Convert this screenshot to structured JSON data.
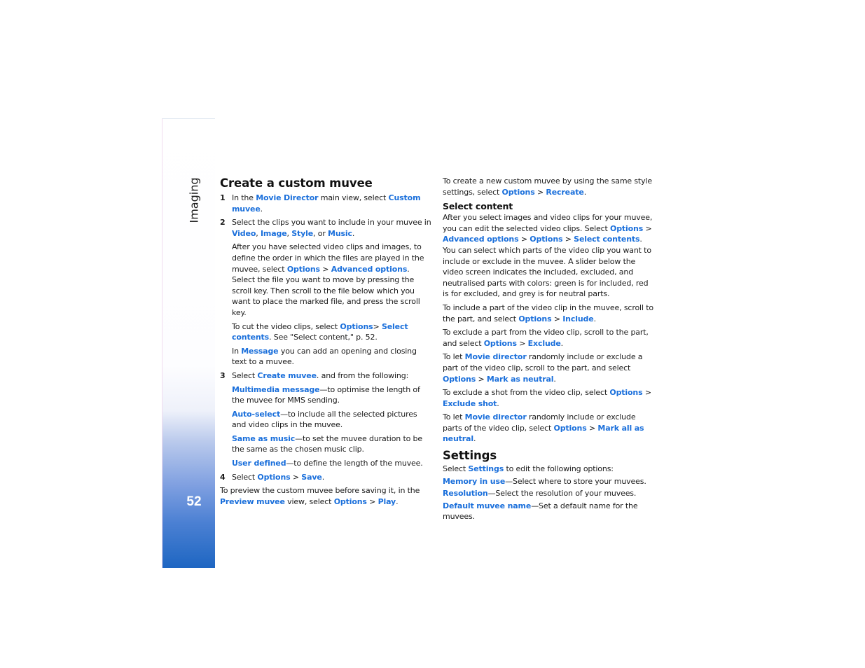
{
  "sidebar": {
    "section": "Imaging",
    "page_number": "52"
  },
  "colors": {
    "link": "#1a6fdb",
    "sidebar_bottom": "#1e66c2"
  },
  "left": {
    "title": "Create a custom muvee",
    "step1": {
      "num": "1",
      "t1": "In the ",
      "l1": "Movie Director",
      "t2": " main view, select ",
      "l2": "Custom muvee",
      "t3": "."
    },
    "step2": {
      "num": "2",
      "t1": "Select the clips you want to include in your muvee in ",
      "l1": "Video",
      "t2": ", ",
      "l2": "Image",
      "t3": ", ",
      "l3": "Style",
      "t4": ", or ",
      "l4": "Music",
      "t5": "."
    },
    "para_order": {
      "t1": "After you have selected video clips and images, to define the order in which the files are played in the muvee, select ",
      "l1": "Options",
      "t2": " > ",
      "l2": "Advanced options",
      "t3": ". Select the file you want to move by pressing the scroll key. Then scroll to the file below which you want to place the marked file, and press the scroll key."
    },
    "para_cut": {
      "t1": "To cut the video clips, select ",
      "l1": "Options",
      "t2": "> ",
      "l2": "Select contents",
      "t3": ". See \"Select content,\" p. 52."
    },
    "para_message": {
      "t1": "In ",
      "l1": "Message",
      "t2": " you can add an opening and closing text to a muvee."
    },
    "step3": {
      "num": "3",
      "t1": "Select ",
      "l1": "Create muvee",
      "t2": ". and from the following:"
    },
    "options": [
      {
        "label": "Multimedia message",
        "desc": "—to optimise the length of the muvee for MMS sending."
      },
      {
        "label": "Auto-select",
        "desc": "—to include all the selected pictures and video clips in the muvee."
      },
      {
        "label": "Same as music",
        "desc": "—to set the muvee duration to be the same as the chosen music clip."
      },
      {
        "label": "User defined",
        "desc": "—to define the length of the muvee."
      }
    ],
    "step4": {
      "num": "4",
      "t1": "Select ",
      "l1": "Options",
      "t2": " > ",
      "l2": "Save",
      "t3": "."
    },
    "para_preview": {
      "t1": "To preview the custom muvee before saving it, in the ",
      "l1": "Preview muvee",
      "t2": " view, select ",
      "l2": "Options",
      "t3": " > ",
      "l3": "Play",
      "t4": "."
    }
  },
  "right": {
    "para_recreate": {
      "t1": "To create a new custom muvee by using the same style settings, select ",
      "l1": "Options",
      "t2": " > ",
      "l2": "Recreate",
      "t3": "."
    },
    "select_content_title": "Select content",
    "para_select": {
      "t1": "After you select images and video clips for your muvee, you can edit the selected video clips. Select ",
      "l1": "Options",
      "t2": " > ",
      "l2": "Advanced options",
      "t3": " > ",
      "l3": "Options",
      "t4": " > ",
      "l4": "Select contents",
      "t5": ". You can select which parts of the video clip you want to include or exclude in the muvee. A slider below the video screen indicates the included, excluded, and neutralised parts with colors: green is for included, red is for excluded, and grey is for neutral parts."
    },
    "para_include": {
      "t1": "To include a part of the video clip in the muvee, scroll to the part, and select ",
      "l1": "Options",
      "t2": " > ",
      "l2": "Include",
      "t3": "."
    },
    "para_exclude": {
      "t1": "To exclude a part from the video clip, scroll to the part, and select ",
      "l1": "Options",
      "t2": " > ",
      "l2": "Exclude",
      "t3": "."
    },
    "para_neutral": {
      "t1": "To let ",
      "l1": "Movie director",
      "t2": " randomly include or exclude a part of the video clip, scroll to the part, and select ",
      "l2": "Options",
      "t3": " > ",
      "l3": "Mark as neutral",
      "t4": "."
    },
    "para_shot": {
      "t1": "To exclude a shot from the video clip, select ",
      "l1": "Options",
      "t2": " > ",
      "l2": "Exclude shot",
      "t3": "."
    },
    "para_all_neutral": {
      "t1": "To let ",
      "l1": "Movie director",
      "t2": " randomly include or exclude parts of the video clip, select ",
      "l2": "Options",
      "t3": " > ",
      "l3": "Mark all as neutral",
      "t4": "."
    },
    "settings_title": "Settings",
    "para_settings": {
      "t1": "Select ",
      "l1": "Settings",
      "t2": " to edit the following options:"
    },
    "settings_options": [
      {
        "label": "Memory in use",
        "desc": "—Select where to store your muvees."
      },
      {
        "label": "Resolution",
        "desc": "—Select the resolution of your muvees."
      },
      {
        "label": "Default muvee name",
        "desc": "—Set a default name for the muvees."
      }
    ]
  }
}
